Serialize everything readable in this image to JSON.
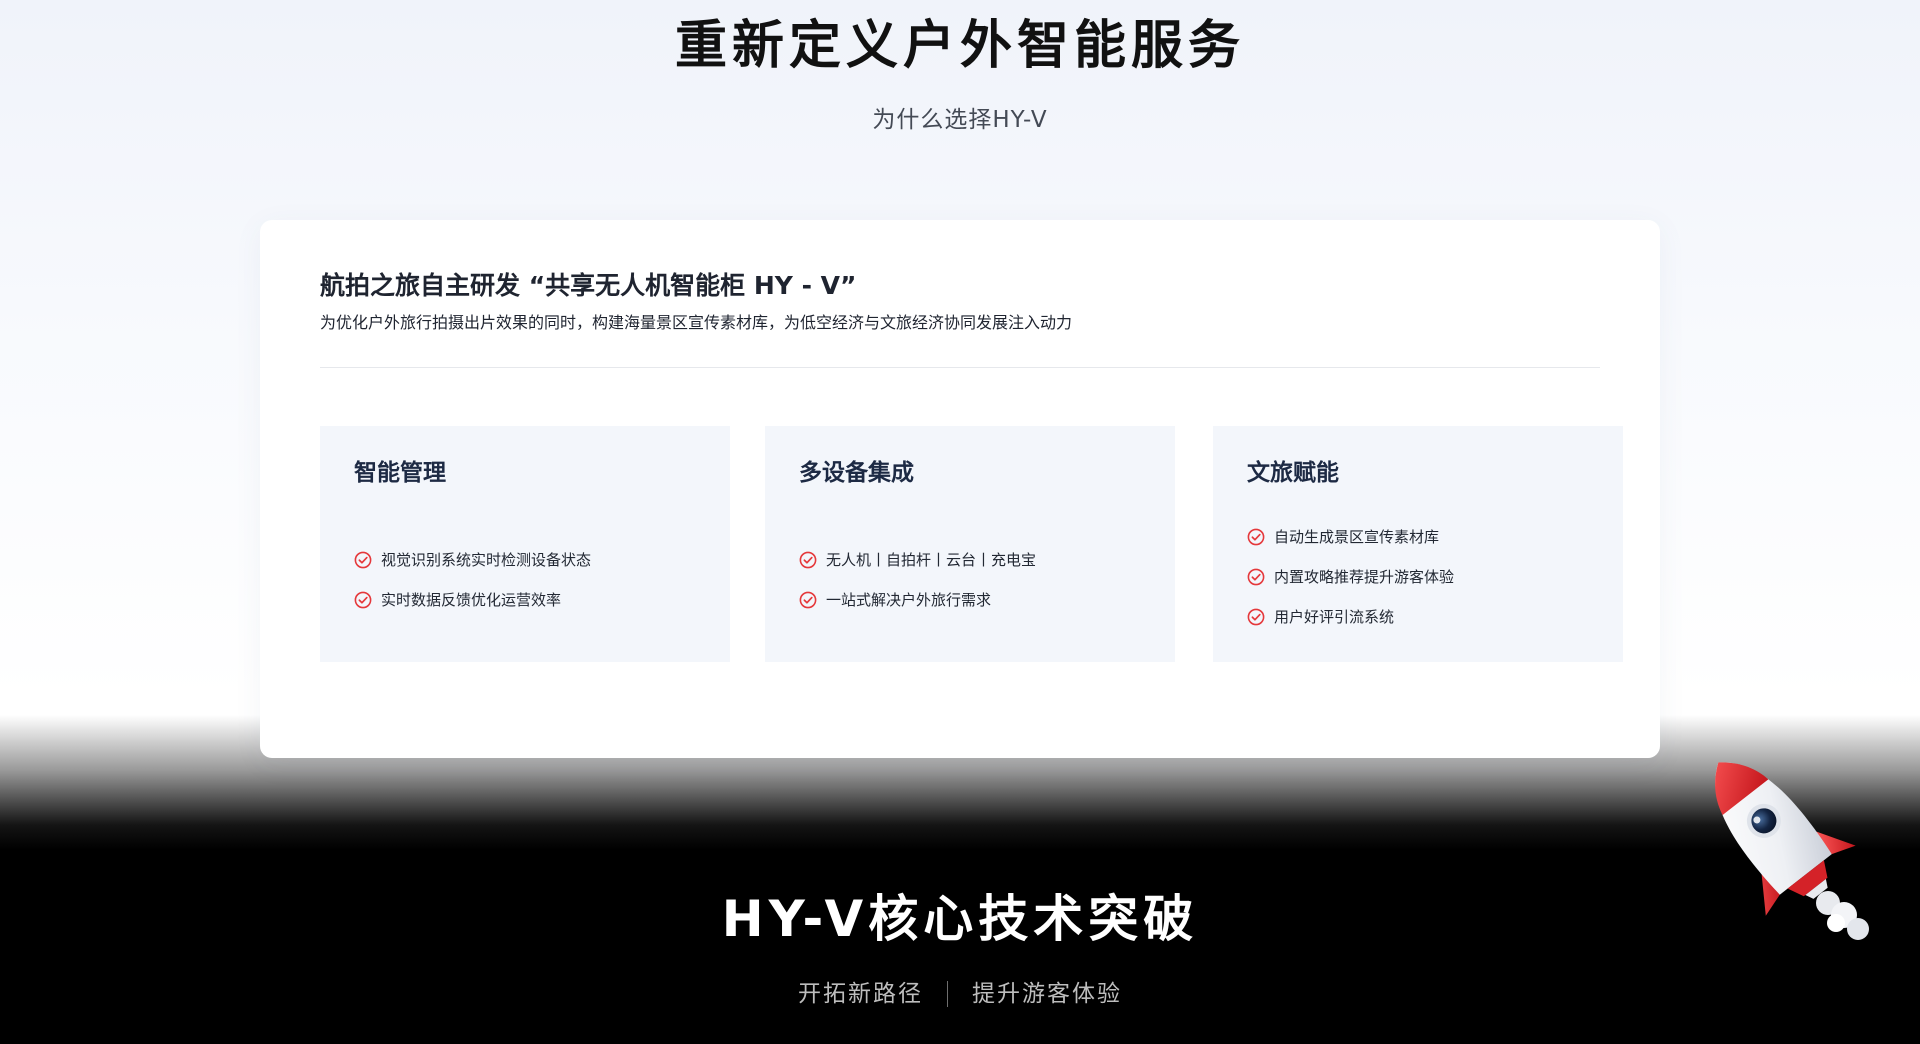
{
  "hero": {
    "title": "重新定义户外智能服务",
    "subtitle": "为什么选择HY-V"
  },
  "intro_card": {
    "heading": "航拍之旅自主研发 “共享无人机智能柜 HY - V”",
    "description": "为优化户外旅行拍摄出片效果的同时，构建海量景区宣传素材库，为低空经济与文旅经济协同发展注入动力"
  },
  "features": [
    {
      "title": "智能管理",
      "items": [
        "视觉识别系统实时检测设备状态",
        "实时数据反馈优化运营效率"
      ]
    },
    {
      "title": "多设备集成",
      "items": [
        "无人机丨自拍杆丨云台丨充电宝",
        "一站式解决户外旅行需求"
      ]
    },
    {
      "title": "文旅赋能",
      "items": [
        "自动生成景区宣传素材库",
        "内置攻略推荐提升游客体验",
        "用户好评引流系统"
      ]
    }
  ],
  "tech_section": {
    "title": "HY-V核心技术突破",
    "taglines": [
      "开拓新路径",
      "提升游客体验"
    ]
  },
  "colors": {
    "accent_red": "#e5383b",
    "feature_bg": "#f3f6fb",
    "title_dark": "#1d2a44",
    "dark_bg": "#000000"
  },
  "icons": {
    "check": "check-circle-icon",
    "rocket": "rocket-icon"
  }
}
